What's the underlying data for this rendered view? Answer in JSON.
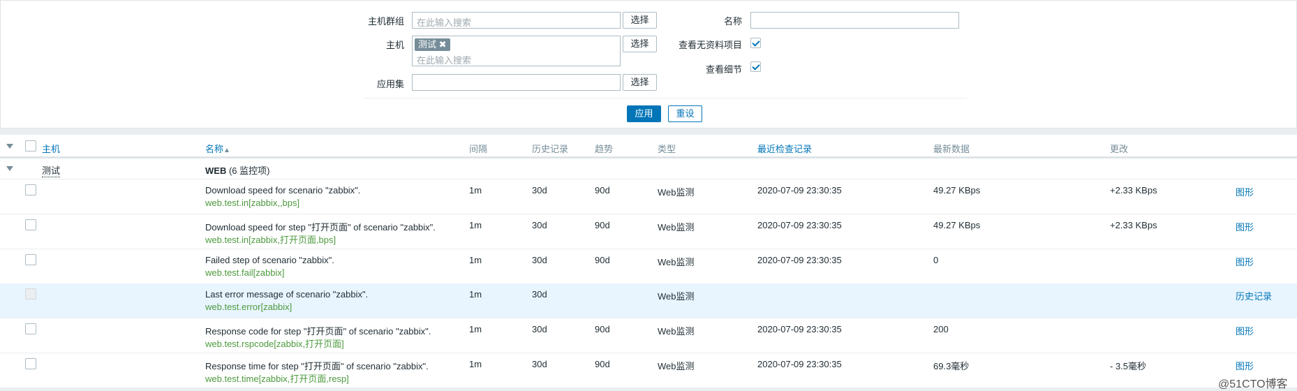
{
  "filter": {
    "host_groups": {
      "label": "主机群组",
      "placeholder": "在此输入搜索",
      "select": "选择"
    },
    "hosts": {
      "label": "主机",
      "tag": "测试",
      "placeholder": "在此输入搜索",
      "select": "选择"
    },
    "application": {
      "label": "应用集",
      "value": "",
      "select": "选择"
    },
    "name": {
      "label": "名称",
      "value": ""
    },
    "show_without_data": {
      "label": "查看无资料项目",
      "checked": true
    },
    "show_details": {
      "label": "查看细节",
      "checked": true
    },
    "apply": "应用",
    "reset": "重设"
  },
  "table": {
    "headers": {
      "host": "主机",
      "name": "名称",
      "sort_icon": "▲",
      "interval": "间隔",
      "history": "历史记录",
      "trends": "趋势",
      "type": "类型",
      "last_check": "最近检查记录",
      "last_value": "最新数据",
      "change": "更改"
    },
    "group": {
      "host": "测试",
      "app": "WEB",
      "count": "(6 监控项)"
    },
    "rows": [
      {
        "name": "Download speed for scenario \"zabbix\".",
        "key": "web.test.in[zabbix,,bps]",
        "interval": "1m",
        "history": "30d",
        "trends": "90d",
        "type": "Web监测",
        "last_check": "2020-07-09 23:30:35",
        "last_value": "49.27 KBps",
        "change": "+2.33 KBps",
        "action": "图形",
        "highlight": false
      },
      {
        "name": "Download speed for step \"打开页面\" of scenario \"zabbix\".",
        "key": "web.test.in[zabbix,打开页面,bps]",
        "interval": "1m",
        "history": "30d",
        "trends": "90d",
        "type": "Web监测",
        "last_check": "2020-07-09 23:30:35",
        "last_value": "49.27 KBps",
        "change": "+2.33 KBps",
        "action": "图形",
        "highlight": false
      },
      {
        "name": "Failed step of scenario \"zabbix\".",
        "key": "web.test.fail[zabbix]",
        "interval": "1m",
        "history": "30d",
        "trends": "90d",
        "type": "Web监测",
        "last_check": "2020-07-09 23:30:35",
        "last_value": "0",
        "change": "",
        "action": "图形",
        "highlight": false
      },
      {
        "name": "Last error message of scenario \"zabbix\".",
        "key": "web.test.error[zabbix]",
        "interval": "1m",
        "history": "30d",
        "trends": "",
        "type": "Web监测",
        "last_check": "",
        "last_value": "",
        "change": "",
        "action": "历史记录",
        "highlight": true
      },
      {
        "name": "Response code for step \"打开页面\" of scenario \"zabbix\".",
        "key": "web.test.rspcode[zabbix,打开页面]",
        "interval": "1m",
        "history": "30d",
        "trends": "90d",
        "type": "Web监测",
        "last_check": "2020-07-09 23:30:35",
        "last_value": "200",
        "change": "",
        "action": "图形",
        "highlight": false
      },
      {
        "name": "Response time for step \"打开页面\" of scenario \"zabbix\".",
        "key": "web.test.time[zabbix,打开页面,resp]",
        "interval": "1m",
        "history": "30d",
        "trends": "90d",
        "type": "Web监测",
        "last_check": "2020-07-09 23:30:35",
        "last_value": "69.3毫秒",
        "change": "- 3.5毫秒",
        "action": "图形",
        "highlight": false
      }
    ]
  },
  "watermark": "@51CTO博客",
  "colors": {
    "link": "#0275b8",
    "key": "#4d9a3e",
    "highlight_row": "#e8f5ff",
    "tag": "#768d99"
  }
}
